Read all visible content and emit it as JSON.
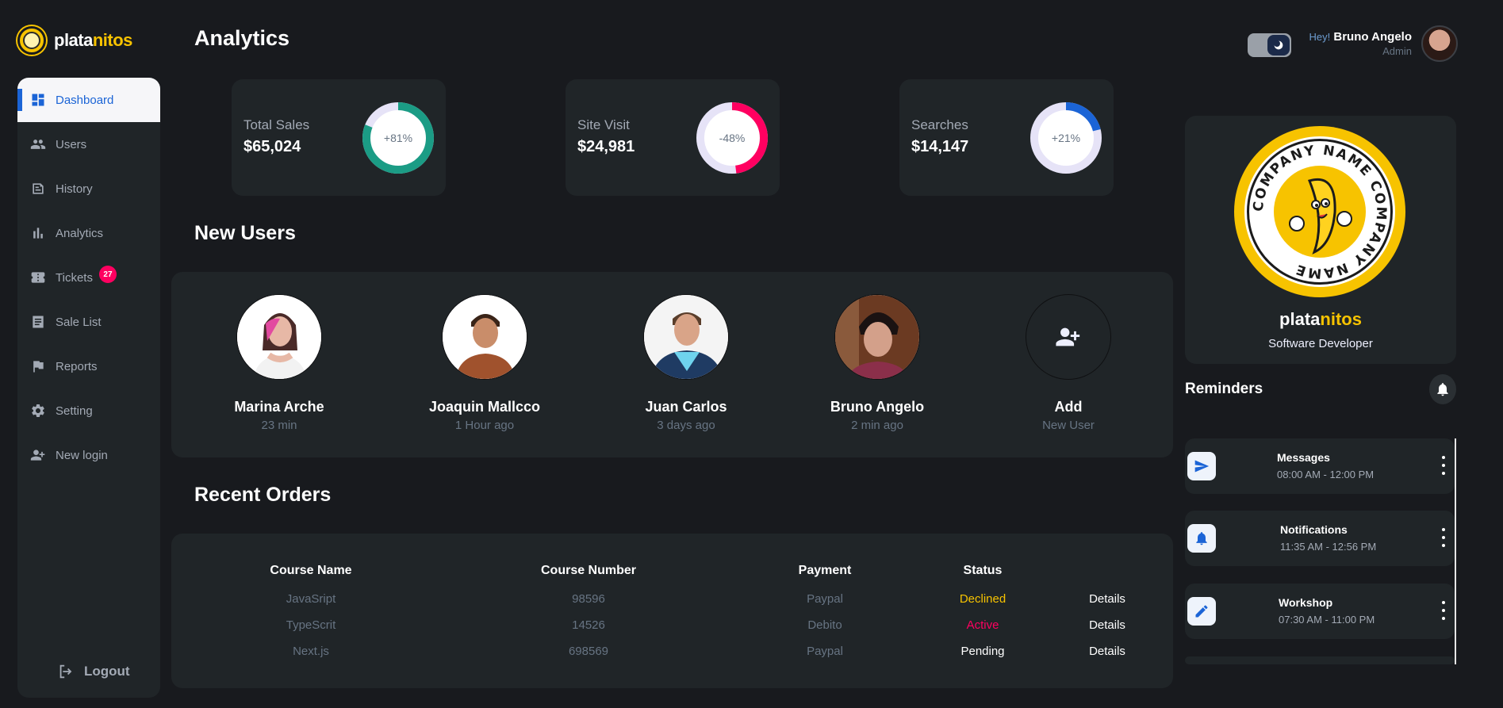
{
  "brand": {
    "part1": "plata",
    "part2": "nitos"
  },
  "sidebar": {
    "items": [
      {
        "label": "Dashboard",
        "icon": "dashboard-icon"
      },
      {
        "label": "Users",
        "icon": "users-icon"
      },
      {
        "label": "History",
        "icon": "history-icon"
      },
      {
        "label": "Analytics",
        "icon": "analytics-icon"
      },
      {
        "label": "Tickets",
        "icon": "tickets-icon",
        "badge": "27"
      },
      {
        "label": "Sale List",
        "icon": "sale-list-icon"
      },
      {
        "label": "Reports",
        "icon": "reports-icon"
      },
      {
        "label": "Setting",
        "icon": "setting-icon"
      },
      {
        "label": "New login",
        "icon": "new-login-icon"
      }
    ],
    "logout": "Logout"
  },
  "header": {
    "title": "Analytics",
    "greeting": "Hey!",
    "user_name": "Bruno Angelo",
    "user_role": "Admin"
  },
  "stats": [
    {
      "label": "Total Sales",
      "value": "$65,024",
      "percent_text": "+81%",
      "percent": 81,
      "color": "#1b9c85"
    },
    {
      "label": "Site Visit",
      "value": "$24,981",
      "percent_text": "-48%",
      "percent": 48,
      "color": "#ff0060"
    },
    {
      "label": "Searches",
      "value": "$14,147",
      "percent_text": "+21%",
      "percent": 21,
      "color": "#1b64d6"
    }
  ],
  "new_users": {
    "title": "New Users",
    "users": [
      {
        "name": "Marina Arche",
        "time": "23 min"
      },
      {
        "name": "Joaquin Mallcco",
        "time": "1 Hour ago"
      },
      {
        "name": "Juan Carlos",
        "time": "3 days ago"
      },
      {
        "name": "Bruno Angelo",
        "time": "2 min ago"
      }
    ],
    "add": {
      "name": "Add",
      "time": "New User"
    }
  },
  "orders": {
    "title": "Recent Orders",
    "headers": [
      "Course Name",
      "Course Number",
      "Payment",
      "Status"
    ],
    "rows": [
      {
        "course": "JavaSript",
        "number": "98596",
        "payment": "Paypal",
        "status": "Declined",
        "status_color": "#f7c300",
        "action": "Details"
      },
      {
        "course": "TypeScrit",
        "number": "14526",
        "payment": "Debito",
        "status": "Active",
        "status_color": "#ff0060",
        "action": "Details"
      },
      {
        "course": "Next.js",
        "number": "698569",
        "payment": "Paypal",
        "status": "Pending",
        "status_color": "#ffffff",
        "action": "Details"
      }
    ]
  },
  "company": {
    "seal_text": "COMPANY NAME COMPANY NAME",
    "name_part1": "plata",
    "name_part2": "nitos",
    "role": "Software Developer"
  },
  "reminders": {
    "title": "Reminders",
    "items": [
      {
        "name": "Messages",
        "time": "08:00 AM - 12:00 PM",
        "icon": "send-icon"
      },
      {
        "name": "Notifications",
        "time": "11:35 AM - 12:56 PM",
        "icon": "bell-icon"
      },
      {
        "name": "Workshop",
        "time": "07:30 AM - 11:00 PM",
        "icon": "edit-icon"
      }
    ]
  },
  "colors": {
    "accent": "#1b64d6",
    "brand": "#f7c300",
    "danger": "#ff0060",
    "success": "#1b9c85"
  }
}
